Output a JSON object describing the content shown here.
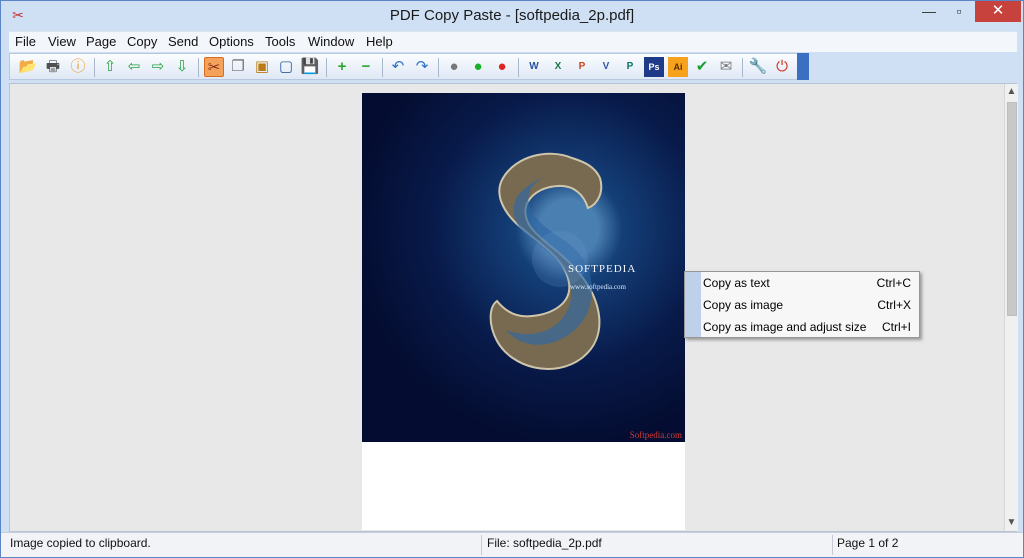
{
  "window": {
    "title": "PDF Copy Paste - [softpedia_2p.pdf]"
  },
  "menu": [
    "File",
    "View",
    "Page",
    "Copy",
    "Send",
    "Options",
    "Tools",
    "Window",
    "Help"
  ],
  "toolbar": [
    "open-folder-icon",
    "print-icon",
    "info-icon",
    "first-page-icon",
    "previous-page-icon",
    "next-page-icon",
    "last-page-icon",
    "copy-scissors-icon",
    "copy-pages-icon",
    "copy-image-icon",
    "frame-icon",
    "save-icon",
    "zoom-in-icon",
    "zoom-out-icon",
    "undo-icon",
    "redo-icon",
    "gray-dot-icon",
    "green-dot-icon",
    "red-dot-icon",
    "word-icon",
    "excel-icon",
    "powerpoint-icon",
    "visio-icon",
    "publisher-icon",
    "photoshop-icon",
    "illustrator-icon",
    "check-icon",
    "mail-icon",
    "tools-icon",
    "power-icon"
  ],
  "document": {
    "watermark": "SOFTPEDIA",
    "site": "www.softpedia.com",
    "corner": "Softpedia.com"
  },
  "context_menu": {
    "items": [
      {
        "label": "Copy as text",
        "shortcut": "Ctrl+C"
      },
      {
        "label": "Copy as image",
        "shortcut": "Ctrl+X"
      },
      {
        "label": "Copy as image and adjust size",
        "shortcut": "Ctrl+I"
      }
    ]
  },
  "status": {
    "message": "Image copied to clipboard.",
    "file": "File: softpedia_2p.pdf",
    "page": "Page 1 of 2"
  }
}
